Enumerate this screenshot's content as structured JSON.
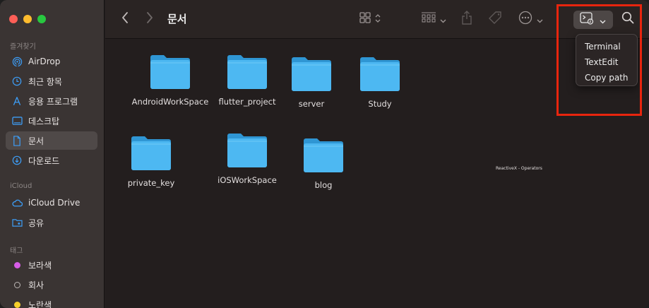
{
  "window": {
    "title": "문서"
  },
  "sidebar": {
    "favorites_title": "즐겨찾기",
    "favorites": [
      {
        "label": "AirDrop",
        "icon": "airdrop-icon"
      },
      {
        "label": "최근 항목",
        "icon": "clock-icon"
      },
      {
        "label": "응용 프로그램",
        "icon": "applications-icon"
      },
      {
        "label": "데스크탑",
        "icon": "desktop-icon"
      },
      {
        "label": "문서",
        "icon": "document-icon"
      },
      {
        "label": "다운로드",
        "icon": "download-icon"
      }
    ],
    "icloud_title": "iCloud",
    "icloud": [
      {
        "label": "iCloud Drive",
        "icon": "cloud-icon"
      },
      {
        "label": "공유",
        "icon": "shared-folder-icon"
      }
    ],
    "tags_title": "태그",
    "tags": [
      {
        "label": "보라색",
        "color": "#d65ce6"
      },
      {
        "label": "회사",
        "color": ""
      },
      {
        "label": "노란색",
        "color": "#f5cf2a"
      }
    ]
  },
  "toolbar": {
    "view_icon": "grid-view-icon",
    "group_icon": "group-by-icon",
    "share_icon": "share-icon",
    "tag_icon": "tag-icon",
    "more_icon": "ellipsis-icon",
    "open_in_icon": "open-in-terminal-icon",
    "search_icon": "search-icon"
  },
  "folders": [
    {
      "name": "AndroidWorkSpace"
    },
    {
      "name": "flutter_project"
    },
    {
      "name": "server"
    },
    {
      "name": "Study"
    },
    {
      "name": "private_key"
    },
    {
      "name": "iOSWorkSpace"
    },
    {
      "name": "blog"
    }
  ],
  "floating_caption": "ReactiveX - Operators",
  "popup_menu": {
    "items": [
      {
        "label": "Terminal"
      },
      {
        "label": "TextEdit"
      },
      {
        "label": "Copy path"
      }
    ]
  },
  "colors": {
    "highlight": "#e8250e",
    "folder": "#4db8f2",
    "accent": "#3d9df6"
  }
}
